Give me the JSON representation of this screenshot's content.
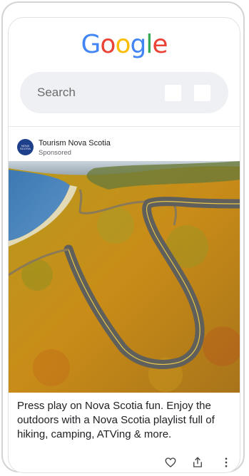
{
  "logo": {
    "letters": [
      "G",
      "o",
      "o",
      "g",
      "l",
      "e"
    ],
    "colors": [
      "#4285F4",
      "#EA4335",
      "#FBBC05",
      "#4285F4",
      "#34A853",
      "#EA4335"
    ]
  },
  "search": {
    "label": "Search"
  },
  "ad": {
    "advertiser": "Tourism Nova Scotia",
    "sponsored": "Sponsored",
    "avatar_text": "NOVA SCOTIA",
    "caption": "Press play on Nova Scotia fun. Enjoy the outdoors with a Nova Scotia playlist full of hiking, camping, ATVing & more.",
    "icons": [
      "heart-icon",
      "share-icon",
      "more-vert-icon"
    ]
  },
  "colors": {
    "search_bg": "#eef0f4",
    "avatar_bg": "#1e3f8a"
  }
}
